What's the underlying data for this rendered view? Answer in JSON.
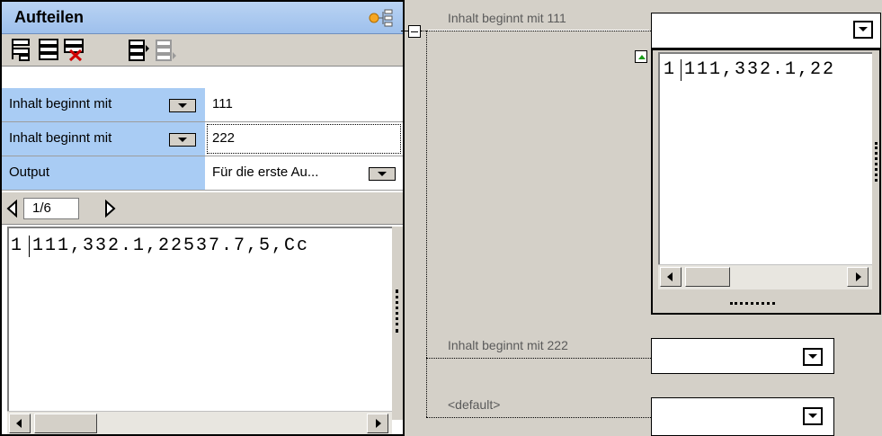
{
  "panel": {
    "title": "Aufteilen",
    "rows": [
      {
        "label": "Inhalt beginnt mit",
        "value": "111"
      },
      {
        "label": "Inhalt beginnt mit",
        "value": "222"
      },
      {
        "label": "Output",
        "value": "Für die erste Au..."
      }
    ],
    "pager": "1/6",
    "preview_line_number": "1",
    "preview_text": "111,332.1,22537.7,5,Cc"
  },
  "flow": {
    "branches": [
      {
        "label": "Inhalt beginnt mit 111"
      },
      {
        "label": "Inhalt beginnt mit 222"
      },
      {
        "label": "<default>"
      }
    ],
    "output_preview": {
      "line_number": "1",
      "text": "111,332.1,22"
    }
  },
  "icons": [
    "tree-icon",
    "add-condition-icon",
    "insert-condition-icon",
    "delete-condition-icon",
    "move-up-icon",
    "move-down-icon",
    "previous-icon",
    "next-icon",
    "collapse-icon",
    "expand-icon"
  ],
  "colors": {
    "label_bg": "#a9ccf4",
    "title_bg": "#b9d3f3",
    "window_bg": "#d4d0c8"
  }
}
